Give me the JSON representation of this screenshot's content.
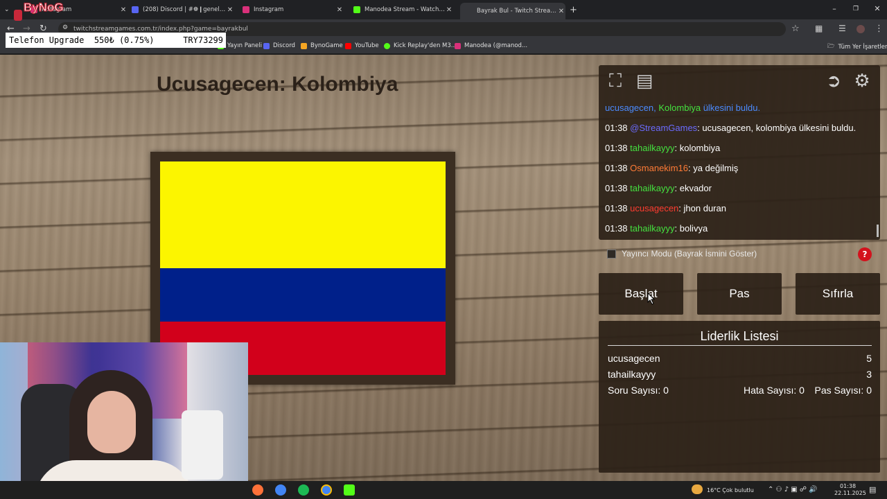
{
  "browser": {
    "tabs": [
      {
        "title": "Instagram",
        "color": "#d9307a"
      },
      {
        "title": "(208) Discord | #❁❙genel-sohbet",
        "color": "#5865f2"
      },
      {
        "title": "Instagram",
        "color": "#d9307a"
      },
      {
        "title": "Manodea Stream - Watch Live on Kick",
        "color": "#53fc18"
      },
      {
        "title": "Bayrak Bul - Twitch Stream Games",
        "color": "#9146ff"
      }
    ],
    "new_tab": "+",
    "url": "twitchstreamgames.com.tr/index.php?game=bayrakbul",
    "bookmarks": [
      {
        "label": "Yayın Paneli",
        "color": "#53fc18"
      },
      {
        "label": "Discord",
        "color": "#5865f2"
      },
      {
        "label": "BynoGame",
        "color": "#f5a623"
      },
      {
        "label": "YouTube",
        "color": "#ff0000"
      },
      {
        "label": "Kick Replay'den M3...",
        "color": "#53fc18"
      },
      {
        "label": "Manodea (@manod...",
        "color": "#d9307a"
      }
    ],
    "all_bookmarks": "Tüm Yer İşaretleri"
  },
  "overlay": {
    "ticker_item": "Telefon Upgrade",
    "ticker_price": "550₺ (0.75%)",
    "ticker_code": "TRY73299"
  },
  "game": {
    "title": "Ucusagecen: Kolombiya",
    "flag_colors": [
      "#fcf500",
      "#00208a",
      "#d2001b"
    ],
    "chat": {
      "announcement_user": "ucusagecen,",
      "announcement_country": "Kolombiya",
      "announcement_rest": "ülkesini buldu.",
      "messages": [
        {
          "time": "01:38",
          "user": "@StreamGames",
          "color": "#6b6bff",
          "text": ": ucusagecen, kolombiya ülkesini buldu."
        },
        {
          "time": "01:38",
          "user": "tahailkayyy",
          "color": "#44e23f",
          "text": ": kolombiya"
        },
        {
          "time": "01:38",
          "user": "Osmanekim16",
          "color": "#ff7b36",
          "text": ": ya değilmiş"
        },
        {
          "time": "01:38",
          "user": "tahailkayyy",
          "color": "#44e23f",
          "text": ": ekvador"
        },
        {
          "time": "01:38",
          "user": "ucusagecen",
          "color": "#ff3b2f",
          "text": ": jhon duran"
        },
        {
          "time": "01:38",
          "user": "tahailkayyy",
          "color": "#44e23f",
          "text": ": bolivya"
        }
      ]
    },
    "streamer_mode_label": "Yayıncı Modu (Bayrak İsmini Göster)",
    "help": "?",
    "buttons": {
      "start": "Başlat",
      "pass": "Pas",
      "reset": "Sıfırla"
    },
    "leaderboard": {
      "title": "Liderlik Listesi",
      "rows": [
        {
          "name": "ucusagecen",
          "score": "5"
        },
        {
          "name": "tahailkayyy",
          "score": "3"
        }
      ],
      "question_count": "Soru Sayısı: 0",
      "error_count": "Hata Sayısı: 0",
      "pass_count": "Pas Sayısı: 0"
    }
  },
  "taskbar": {
    "weather": "16°C  Çok bulutlu",
    "time": "01:38",
    "date": "22.11.2025"
  }
}
